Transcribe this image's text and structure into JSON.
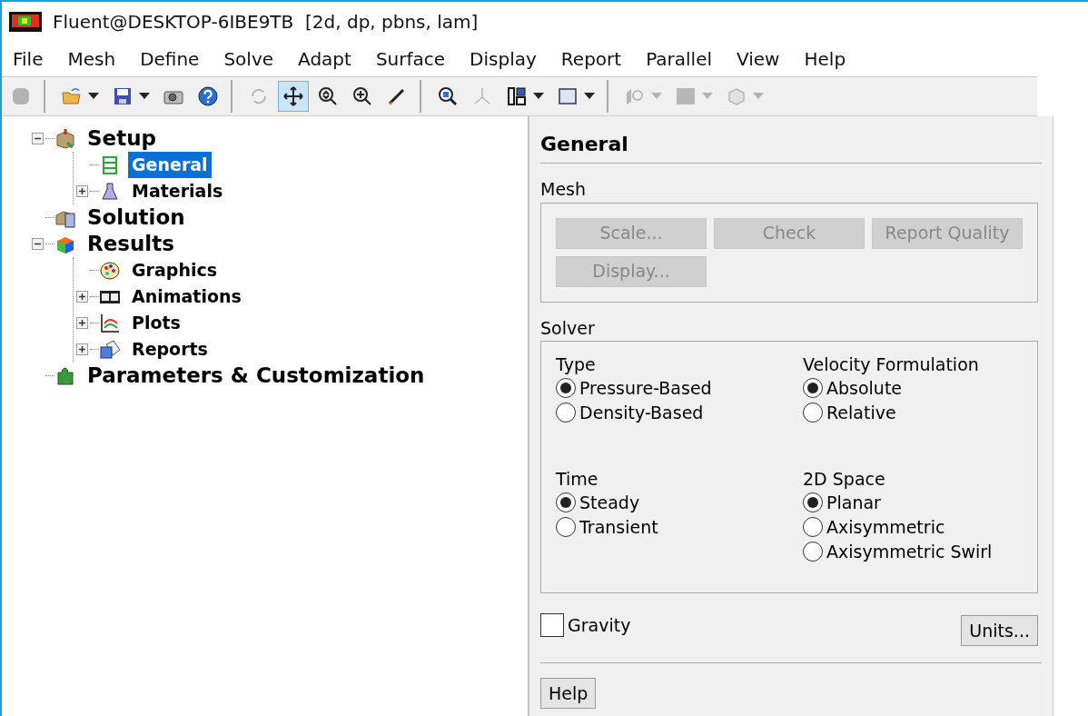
{
  "window": {
    "title": "Fluent@DESKTOP-6IBE9TB  [2d, dp, pbns, lam]"
  },
  "menu": [
    "File",
    "Mesh",
    "Define",
    "Solve",
    "Adapt",
    "Surface",
    "Display",
    "Report",
    "Parallel",
    "View",
    "Help"
  ],
  "toolbar": [
    {
      "kind": "shape",
      "disabled": true,
      "selected": false,
      "dropdown": false
    },
    {
      "kind": "sep"
    },
    {
      "kind": "open",
      "disabled": false,
      "selected": false,
      "dropdown": true
    },
    {
      "kind": "save",
      "disabled": false,
      "selected": false,
      "dropdown": true
    },
    {
      "kind": "camera",
      "disabled": false,
      "selected": false,
      "dropdown": false
    },
    {
      "kind": "help",
      "disabled": false,
      "selected": false,
      "dropdown": false
    },
    {
      "kind": "sep"
    },
    {
      "kind": "rotate",
      "disabled": true,
      "selected": false,
      "dropdown": false
    },
    {
      "kind": "move",
      "disabled": false,
      "selected": true,
      "dropdown": false
    },
    {
      "kind": "zoomfit",
      "disabled": false,
      "selected": false,
      "dropdown": false
    },
    {
      "kind": "zoomin",
      "disabled": false,
      "selected": false,
      "dropdown": false
    },
    {
      "kind": "probe",
      "disabled": false,
      "selected": false,
      "dropdown": false
    },
    {
      "kind": "sep"
    },
    {
      "kind": "fit",
      "disabled": false,
      "selected": false,
      "dropdown": false
    },
    {
      "kind": "axes",
      "disabled": true,
      "selected": false,
      "dropdown": false
    },
    {
      "kind": "layout",
      "disabled": false,
      "selected": false,
      "dropdown": true
    },
    {
      "kind": "background",
      "disabled": false,
      "selected": false,
      "dropdown": true
    },
    {
      "kind": "sep"
    },
    {
      "kind": "view",
      "disabled": true,
      "selected": false,
      "dropdown": true
    },
    {
      "kind": "square",
      "disabled": true,
      "selected": false,
      "dropdown": true
    },
    {
      "kind": "cube",
      "disabled": true,
      "selected": false,
      "dropdown": true
    }
  ],
  "tree": [
    {
      "label": "Setup",
      "kind": "setup",
      "major": true,
      "expanded": true,
      "selected": false,
      "children": [
        {
          "label": "General",
          "kind": "general",
          "selected": true
        },
        {
          "label": "Materials",
          "kind": "materials",
          "expanded": false,
          "selected": false
        }
      ]
    },
    {
      "label": "Solution",
      "kind": "solution",
      "major": true,
      "selected": false
    },
    {
      "label": "Results",
      "kind": "results",
      "major": true,
      "expanded": true,
      "selected": false,
      "children": [
        {
          "label": "Graphics",
          "kind": "graphics",
          "selected": false
        },
        {
          "label": "Animations",
          "kind": "animations",
          "expanded": false,
          "selected": false
        },
        {
          "label": "Plots",
          "kind": "plots",
          "expanded": false,
          "selected": false
        },
        {
          "label": "Reports",
          "kind": "reports",
          "expanded": false,
          "selected": false
        }
      ]
    },
    {
      "label": "Parameters & Customization",
      "kind": "parameters",
      "major": true,
      "selected": false
    }
  ],
  "panel": {
    "title": "General",
    "mesh": {
      "title": "Mesh",
      "buttons": [
        {
          "label": "Scale...",
          "disabled": true
        },
        {
          "label": "Check",
          "disabled": true
        },
        {
          "label": "Report Quality",
          "disabled": true
        },
        {
          "label": "Display...",
          "disabled": true
        }
      ]
    },
    "solver": {
      "title": "Solver",
      "groups": [
        {
          "title": "Type",
          "options": [
            {
              "label": "Pressure-Based",
              "selected": true
            },
            {
              "label": "Density-Based",
              "selected": false
            }
          ]
        },
        {
          "title": "Velocity Formulation",
          "options": [
            {
              "label": "Absolute",
              "selected": true
            },
            {
              "label": "Relative",
              "selected": false
            }
          ]
        },
        {
          "title": "Time",
          "options": [
            {
              "label": "Steady",
              "selected": true
            },
            {
              "label": "Transient",
              "selected": false
            }
          ]
        },
        {
          "title": "2D Space",
          "options": [
            {
              "label": "Planar",
              "selected": true
            },
            {
              "label": "Axisymmetric",
              "selected": false
            },
            {
              "label": "Axisymmetric Swirl",
              "selected": false
            }
          ]
        }
      ]
    },
    "gravity": {
      "label": "Gravity",
      "checked": false
    },
    "units_button": "Units...",
    "help_button": "Help"
  }
}
